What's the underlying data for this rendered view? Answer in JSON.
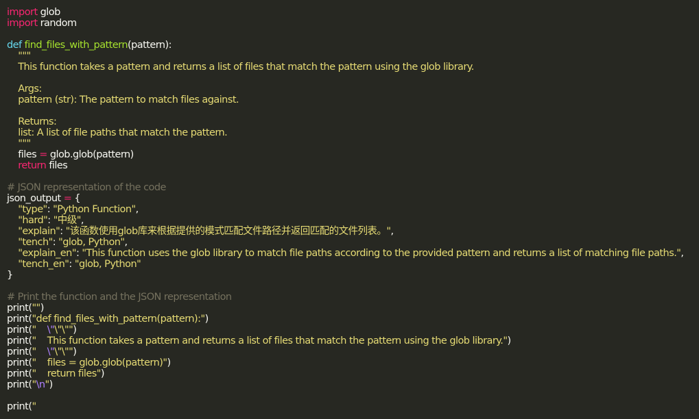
{
  "editor": {
    "colors": {
      "background": "#272822",
      "plain": "#f8f8f2",
      "keyword": "#f92672",
      "def": "#66d9ef",
      "function_name": "#a6e22e",
      "string": "#e6db74",
      "comment": "#75715e",
      "escape": "#ae81ff"
    },
    "lines": [
      [
        {
          "t": "keyword",
          "v": "import"
        },
        {
          "t": "plain",
          "v": " glob"
        }
      ],
      [
        {
          "t": "keyword",
          "v": "import"
        },
        {
          "t": "plain",
          "v": " random"
        }
      ],
      [],
      [
        {
          "t": "def",
          "v": "def"
        },
        {
          "t": "plain",
          "v": " "
        },
        {
          "t": "func",
          "v": "find_files_with_pattern"
        },
        {
          "t": "plain",
          "v": "(pattern):"
        }
      ],
      [
        {
          "t": "string",
          "v": "    \"\"\""
        }
      ],
      [
        {
          "t": "string",
          "v": "    This function takes a pattern and returns a list of files that match the pattern using the glob library."
        }
      ],
      [],
      [
        {
          "t": "string",
          "v": "    Args:"
        }
      ],
      [
        {
          "t": "string",
          "v": "    pattern (str): The pattern to match files against."
        }
      ],
      [],
      [
        {
          "t": "string",
          "v": "    Returns:"
        }
      ],
      [
        {
          "t": "string",
          "v": "    list: A list of file paths that match the pattern."
        }
      ],
      [
        {
          "t": "string",
          "v": "    \"\"\""
        }
      ],
      [
        {
          "t": "plain",
          "v": "    files "
        },
        {
          "t": "operator",
          "v": "="
        },
        {
          "t": "plain",
          "v": " glob.glob(pattern)"
        }
      ],
      [
        {
          "t": "plain",
          "v": "    "
        },
        {
          "t": "keyword",
          "v": "return"
        },
        {
          "t": "plain",
          "v": " files"
        }
      ],
      [],
      [
        {
          "t": "comment",
          "v": "# JSON representation of the code"
        }
      ],
      [
        {
          "t": "plain",
          "v": "json_output "
        },
        {
          "t": "operator",
          "v": "="
        },
        {
          "t": "plain",
          "v": " {"
        }
      ],
      [
        {
          "t": "plain",
          "v": "    "
        },
        {
          "t": "string",
          "v": "\"type\""
        },
        {
          "t": "plain",
          "v": ": "
        },
        {
          "t": "string",
          "v": "\"Python Function\""
        },
        {
          "t": "plain",
          "v": ","
        }
      ],
      [
        {
          "t": "plain",
          "v": "    "
        },
        {
          "t": "string",
          "v": "\"hard\""
        },
        {
          "t": "plain",
          "v": ": "
        },
        {
          "t": "string",
          "v": "\"中级\""
        },
        {
          "t": "plain",
          "v": ","
        }
      ],
      [
        {
          "t": "plain",
          "v": "    "
        },
        {
          "t": "string",
          "v": "\"explain\""
        },
        {
          "t": "plain",
          "v": ": "
        },
        {
          "t": "string",
          "v": "\"该函数使用glob库来根据提供的模式匹配文件路径并返回匹配的文件列表。\""
        },
        {
          "t": "plain",
          "v": ","
        }
      ],
      [
        {
          "t": "plain",
          "v": "    "
        },
        {
          "t": "string",
          "v": "\"tench\""
        },
        {
          "t": "plain",
          "v": ": "
        },
        {
          "t": "string",
          "v": "\"glob, Python\""
        },
        {
          "t": "plain",
          "v": ","
        }
      ],
      [
        {
          "t": "plain",
          "v": "    "
        },
        {
          "t": "string",
          "v": "\"explain_en\""
        },
        {
          "t": "plain",
          "v": ": "
        },
        {
          "t": "string",
          "v": "\"This function uses the glob library to match file paths according to the provided pattern and returns a list of matching file paths.\""
        },
        {
          "t": "plain",
          "v": ","
        }
      ],
      [
        {
          "t": "plain",
          "v": "    "
        },
        {
          "t": "string",
          "v": "\"tench_en\""
        },
        {
          "t": "plain",
          "v": ": "
        },
        {
          "t": "string",
          "v": "\"glob, Python\""
        }
      ],
      [
        {
          "t": "plain",
          "v": "}"
        }
      ],
      [],
      [
        {
          "t": "comment",
          "v": "# Print the function and the JSON representation"
        }
      ],
      [
        {
          "t": "plain",
          "v": "print("
        },
        {
          "t": "string",
          "v": "\"\""
        },
        {
          "t": "plain",
          "v": ")"
        }
      ],
      [
        {
          "t": "plain",
          "v": "print("
        },
        {
          "t": "string",
          "v": "\"def find_files_with_pattern(pattern):\""
        },
        {
          "t": "plain",
          "v": ")"
        }
      ],
      [
        {
          "t": "plain",
          "v": "print("
        },
        {
          "t": "string",
          "v": "\"    "
        },
        {
          "t": "escape",
          "v": "\\\""
        },
        {
          "t": "string",
          "v": "\\\"\\\"\""
        },
        {
          "t": "plain",
          "v": ")"
        }
      ],
      [
        {
          "t": "plain",
          "v": "print("
        },
        {
          "t": "string",
          "v": "\"    This function takes a pattern and returns a list of files that match the pattern using the glob library.\""
        },
        {
          "t": "plain",
          "v": ")"
        }
      ],
      [
        {
          "t": "plain",
          "v": "print("
        },
        {
          "t": "string",
          "v": "\"    "
        },
        {
          "t": "escape",
          "v": "\\\""
        },
        {
          "t": "string",
          "v": "\\\"\\\"\""
        },
        {
          "t": "plain",
          "v": ")"
        }
      ],
      [
        {
          "t": "plain",
          "v": "print("
        },
        {
          "t": "string",
          "v": "\"    files = glob.glob(pattern)\""
        },
        {
          "t": "plain",
          "v": ")"
        }
      ],
      [
        {
          "t": "plain",
          "v": "print("
        },
        {
          "t": "string",
          "v": "\"    return files\""
        },
        {
          "t": "plain",
          "v": ")"
        }
      ],
      [
        {
          "t": "plain",
          "v": "print("
        },
        {
          "t": "string",
          "v": "\""
        },
        {
          "t": "escape",
          "v": "\\n"
        },
        {
          "t": "string",
          "v": "\""
        },
        {
          "t": "plain",
          "v": ")"
        }
      ],
      [],
      [
        {
          "t": "plain",
          "v": "print("
        },
        {
          "t": "string",
          "v": "\""
        }
      ]
    ]
  }
}
